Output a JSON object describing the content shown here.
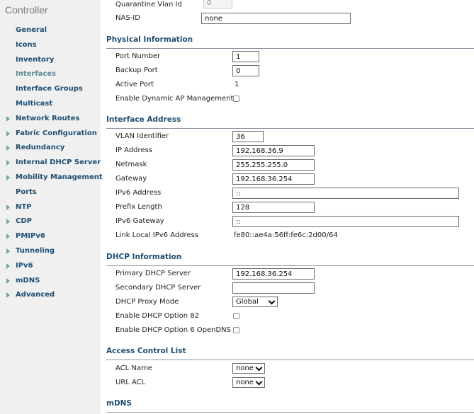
{
  "sidebar": {
    "title": "Controller",
    "items": [
      {
        "label": "General",
        "expandable": false,
        "active": false
      },
      {
        "label": "Icons",
        "expandable": false,
        "active": false
      },
      {
        "label": "Inventory",
        "expandable": false,
        "active": false
      },
      {
        "label": "Interfaces",
        "expandable": false,
        "active": true
      },
      {
        "label": "Interface Groups",
        "expandable": false,
        "active": false
      },
      {
        "label": "Multicast",
        "expandable": false,
        "active": false
      },
      {
        "label": "Network Routes",
        "expandable": true,
        "active": false
      },
      {
        "label": "Fabric Configuration",
        "expandable": true,
        "active": false
      },
      {
        "label": "Redundancy",
        "expandable": true,
        "active": false
      },
      {
        "label": "Internal DHCP Server",
        "expandable": true,
        "active": false
      },
      {
        "label": "Mobility Management",
        "expandable": true,
        "active": false
      },
      {
        "label": "Ports",
        "expandable": false,
        "active": false
      },
      {
        "label": "NTP",
        "expandable": true,
        "active": false
      },
      {
        "label": "CDP",
        "expandable": true,
        "active": false
      },
      {
        "label": "PMIPv6",
        "expandable": true,
        "active": false
      },
      {
        "label": "Tunneling",
        "expandable": true,
        "active": false
      },
      {
        "label": "IPv6",
        "expandable": true,
        "active": false
      },
      {
        "label": "mDNS",
        "expandable": true,
        "active": false
      },
      {
        "label": "Advanced",
        "expandable": true,
        "active": false
      }
    ]
  },
  "top": {
    "quarantine_vlan_label": "Quarantine Vlan Id",
    "quarantine_vlan_value": "0",
    "nas_id_label": "NAS-ID",
    "nas_id_value": "none"
  },
  "physical": {
    "heading": "Physical Information",
    "port_number_label": "Port Number",
    "port_number_value": "1",
    "backup_port_label": "Backup Port",
    "backup_port_value": "0",
    "active_port_label": "Active Port",
    "active_port_value": "1",
    "dynamic_ap_label": "Enable Dynamic AP Management",
    "dynamic_ap_checked": false
  },
  "interface_address": {
    "heading": "Interface Address",
    "vlan_label": "VLAN Identifier",
    "vlan_value": "36",
    "ip_label": "IP Address",
    "ip_value": "192.168.36.9",
    "netmask_label": "Netmask",
    "netmask_value": "255.255.255.0",
    "gateway_label": "Gateway",
    "gateway_value": "192.168.36.254",
    "ipv6_label": "IPv6 Address",
    "ipv6_value": "::",
    "prefix_label": "Prefix Length",
    "prefix_value": "128",
    "ipv6_gw_label": "IPv6 Gateway",
    "ipv6_gw_value": "::",
    "link_local_label": "Link Local IPv6 Address",
    "link_local_value": "fe80::ae4a:56ff:fe6c:2d00/64"
  },
  "dhcp": {
    "heading": "DHCP Information",
    "primary_label": "Primary DHCP Server",
    "primary_value": "192.168.36.254",
    "secondary_label": "Secondary DHCP Server",
    "secondary_value": "",
    "proxy_label": "DHCP Proxy Mode",
    "proxy_value": "Global",
    "opt82_label": "Enable DHCP Option 82",
    "opt82_checked": false,
    "opt6_label": "Enable DHCP Option 6 OpenDNS",
    "opt6_checked": false
  },
  "acl": {
    "heading": "Access Control List",
    "acl_name_label": "ACL Name",
    "acl_name_value": "none",
    "url_acl_label": "URL ACL",
    "url_acl_value": "none"
  },
  "mdns": {
    "heading": "mDNS"
  }
}
